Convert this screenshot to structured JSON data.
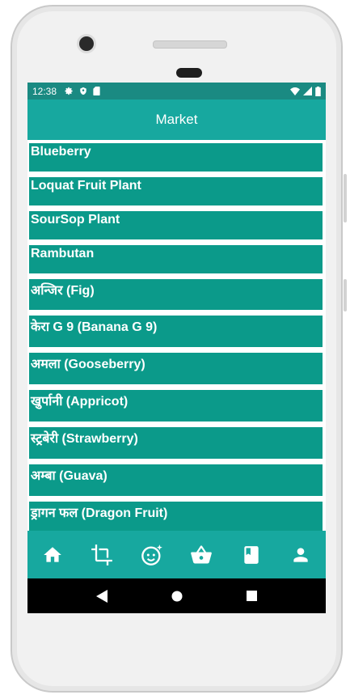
{
  "status_bar": {
    "time": "12:38",
    "left_icons": [
      "gear-icon",
      "shield-icon",
      "sim-card-icon"
    ],
    "right_icons": [
      "wifi-icon",
      "signal-icon",
      "battery-icon"
    ]
  },
  "app_bar": {
    "title": "Market"
  },
  "products": [
    "Blueberry",
    "Loquat Fruit Plant",
    "SourSop Plant",
    "Rambutan",
    "अन्जिर (Fig)",
    "केरा G 9 (Banana G 9)",
    "अमला (Gooseberry)",
    "खुर्पानी (Appricot)",
    "स्ट्रबेरी (Strawberry)",
    "अम्बा (Guava)",
    "ड्रागन फल (Dragon Fruit)"
  ],
  "bottom_nav": [
    "home-icon",
    "crop-icon",
    "face-sparkle-icon",
    "shopping-basket-icon",
    "book-icon",
    "person-icon"
  ],
  "system_nav": [
    "back-icon",
    "home-circle-icon",
    "recents-icon"
  ],
  "colors": {
    "status_bar": "#1a8a82",
    "app_bar": "#17a89f",
    "list_item": "#0b9a8a"
  }
}
